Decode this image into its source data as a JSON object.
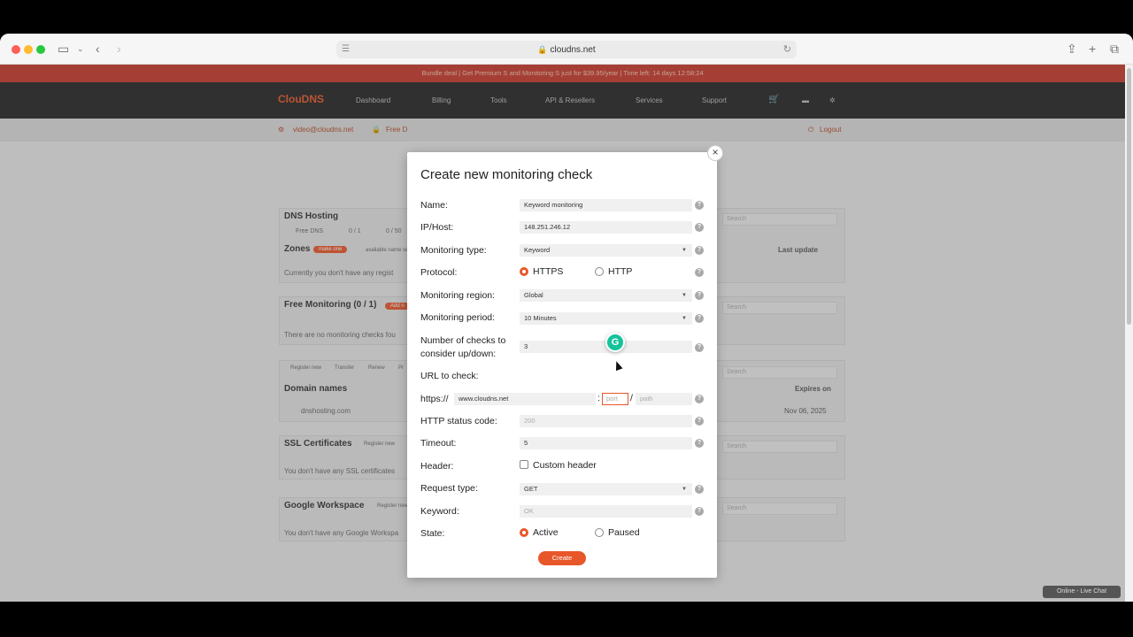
{
  "browser": {
    "url": "cloudns.net",
    "back_icon": "chevron-left-icon",
    "forward_icon": "chevron-right-icon"
  },
  "promo_banner": "Bundle deal | Get Premium S and Monitoring S just for $39.95/year | Time left: 14 days 12:58:24",
  "nav": {
    "logo": "ClouDNS",
    "items": [
      "Dashboard",
      "Billing",
      "Tools",
      "API & Resellers",
      "Services",
      "Support"
    ]
  },
  "subbar": {
    "email": "video@cloudns.net",
    "plan": "Free D",
    "logout": "Logout"
  },
  "background": {
    "dns_hosting": {
      "title": "DNS Hosting",
      "free_dns": "Free DNS",
      "count1": "0 / 1",
      "count2": "0 / 50",
      "zones_label": "Zones",
      "zones_tag": "make one",
      "zones_hint": "available name se",
      "empty": "Currently you don't have any regist",
      "last_update": "Last update",
      "search": "Search"
    },
    "free_monitoring": {
      "title": "Free Monitoring (0 / 1)",
      "tag": "Add n",
      "empty": "There are no monitoring checks fou",
      "search": "Search"
    },
    "domains": {
      "tabs": [
        "Register new",
        "Transfer",
        "Renew",
        "Pr"
      ],
      "title": "Domain names",
      "expires": "Expires on",
      "domain": "dnshosting.com",
      "domain_expiry": "Nov 06, 2025",
      "search": "Search"
    },
    "ssl": {
      "title": "SSL Certificates",
      "tag": "Register new",
      "empty": "You don't have any SSL certificates",
      "search": "Search"
    },
    "workspace": {
      "title": "Google Workspace",
      "tag": "Register new",
      "empty": "You don't have any Google Workspa",
      "search": "Search"
    }
  },
  "modal": {
    "title": "Create new monitoring check",
    "close_label": "×",
    "name_label": "Name:",
    "name_value": "Keyword monitoring",
    "host_label": "IP/Host:",
    "host_value": "148.251.246.12",
    "type_label": "Monitoring type:",
    "type_value": "Keyword",
    "protocol_label": "Protocol:",
    "protocol_options": [
      "HTTPS",
      "HTTP"
    ],
    "protocol_selected": "HTTPS",
    "region_label": "Monitoring region:",
    "region_value": "Global",
    "period_label": "Monitoring period:",
    "period_value": "10 Minutes",
    "checks_label_1": "Number of checks to",
    "checks_label_2": "consider up/down:",
    "checks_value": "3",
    "url_label": "URL to check:",
    "url_prefix": "https://",
    "url_host": "www.cloudns.net",
    "url_colon": ":",
    "url_port_placeholder": "port",
    "url_slash": "/",
    "url_path_placeholder": "path",
    "status_label": "HTTP status code:",
    "status_placeholder": "200",
    "timeout_label": "Timeout:",
    "timeout_value": "5",
    "header_label": "Header:",
    "header_checkbox": "Custom header",
    "request_label": "Request type:",
    "request_value": "GET",
    "keyword_label": "Keyword:",
    "keyword_placeholder": "OK",
    "state_label": "State:",
    "state_options": [
      "Active",
      "Paused"
    ],
    "state_selected": "Active",
    "help_glyph": "?",
    "create_label": "Create"
  },
  "grammarly_glyph": "G",
  "live_chat": "Online - Live Chat",
  "colors": {
    "accent": "#e8572a",
    "promo": "#c63a2d",
    "nav": "#252525"
  }
}
